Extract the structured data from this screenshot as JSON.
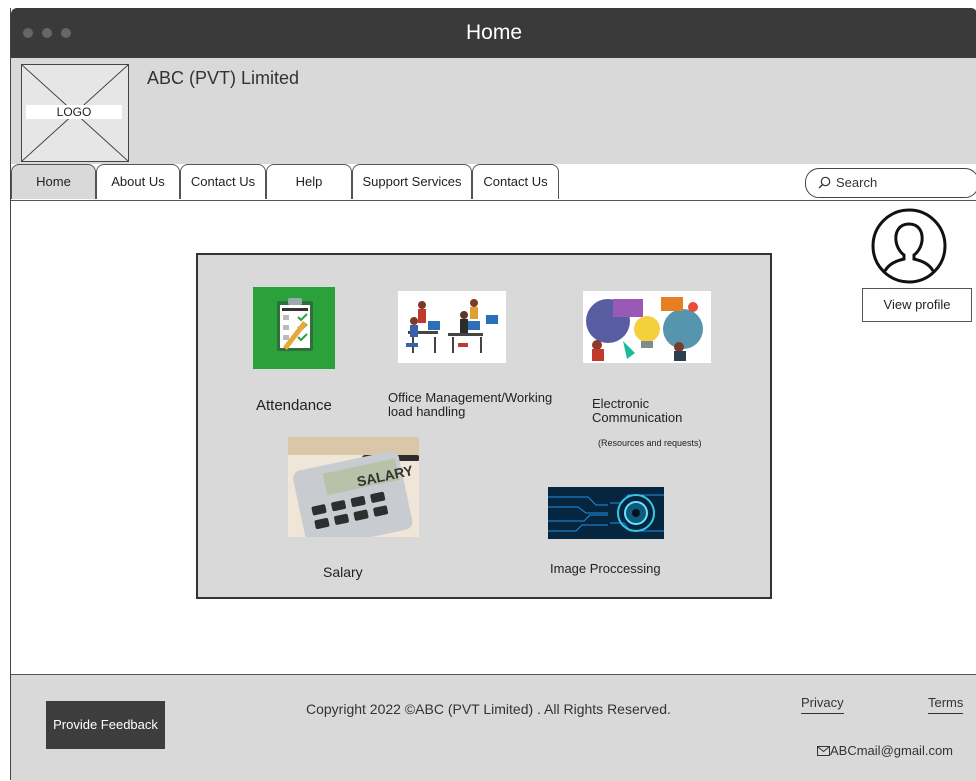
{
  "window": {
    "title": "Home"
  },
  "header": {
    "company_name": "ABC (PVT) Limited",
    "logo_text": "LOGO"
  },
  "nav": {
    "tabs": [
      {
        "label": "Home",
        "active": true
      },
      {
        "label": "About Us"
      },
      {
        "label": "Contact Us"
      },
      {
        "label": "Help"
      },
      {
        "label": "Support Services"
      },
      {
        "label": "Contact Us"
      }
    ],
    "search_placeholder": "Search"
  },
  "modules": {
    "attendance": {
      "label": "Attendance",
      "icon": "attendance-clipboard-image"
    },
    "office": {
      "label": "Office Management/Working\nload handling",
      "icon": "office-workers-image"
    },
    "communication": {
      "label": "Electronic\nCommunication",
      "sublabel": "(Resources and requests)",
      "icon": "communication-bulb-image"
    },
    "salary": {
      "label": "Salary",
      "icon": "salary-calculator-image",
      "calc_text": "SALARY"
    },
    "image_processing": {
      "label": "Image Proccessing",
      "icon": "digital-eye-image"
    }
  },
  "profile": {
    "button_label": "View profile",
    "icon": "user-avatar-icon"
  },
  "footer": {
    "feedback_label": "Provide Feedback",
    "copyright": "Copyright 2022 ©ABC (PVT Limited) . All Rights Reserved.",
    "privacy_label": "Privacy",
    "terms_label": "Terms",
    "email": "ABCmail@gmail.com"
  },
  "colors": {
    "titlebar": "#3a3a3a",
    "header_bg": "#d9d9d9",
    "attendance_green": "#2aa13a",
    "feedback_button": "#3d3d3d"
  }
}
